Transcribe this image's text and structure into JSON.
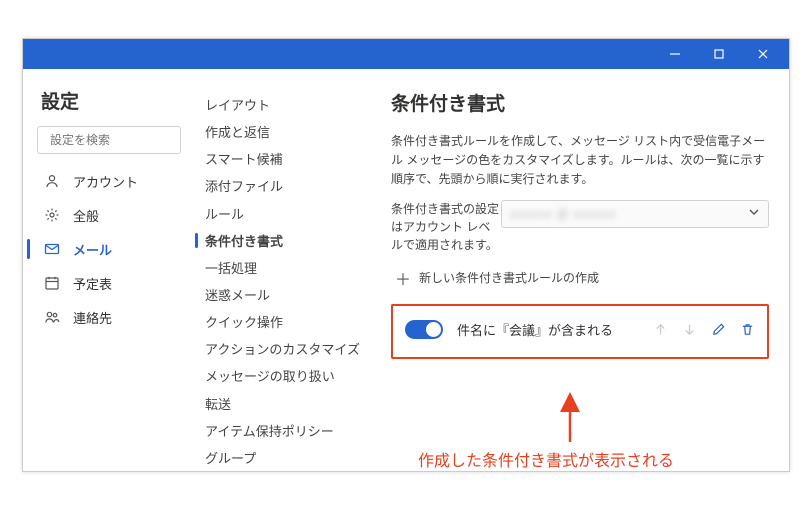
{
  "titlebar": {
    "minimize_label": "Minimize",
    "maximize_label": "Maximize",
    "close_label": "Close"
  },
  "pane1": {
    "title": "設定",
    "search_placeholder": "設定を検索",
    "items": [
      {
        "label": "アカウント",
        "icon": "person"
      },
      {
        "label": "全般",
        "icon": "gear"
      },
      {
        "label": "メール",
        "icon": "mail",
        "active": true
      },
      {
        "label": "予定表",
        "icon": "calendar"
      },
      {
        "label": "連絡先",
        "icon": "people"
      }
    ]
  },
  "pane2": {
    "items": [
      "レイアウト",
      "作成と返信",
      "スマート候補",
      "添付ファイル",
      "ルール",
      "条件付き書式",
      "一括処理",
      "迷惑メール",
      "クイック操作",
      "アクションのカスタマイズ",
      "メッセージの取り扱い",
      "転送",
      "アイテム保持ポリシー",
      "グループ"
    ],
    "active_index": 5
  },
  "pane3": {
    "heading": "条件付き書式",
    "description": "条件付き書式ルールを作成して、メッセージ リスト内で受信電子メール メッセージの色をカスタマイズします。ルールは、次の一覧に示す順序で、先頭から順に実行されます。",
    "account_label": "条件付き書式の設定はアカウント レベルで適用されます。",
    "account_value_masked": "xxxxxx @ xxxxxx",
    "add_rule_label": "新しい条件付き書式ルールの作成",
    "rule": {
      "enabled": true,
      "label": "件名に『会議』が含まれる"
    },
    "action_labels": {
      "move_up": "上へ",
      "move_down": "下へ",
      "edit": "編集",
      "delete": "削除"
    }
  },
  "annotation": {
    "caption": "作成した条件付き書式が表示される",
    "highlight_color": "#e83f1e"
  }
}
